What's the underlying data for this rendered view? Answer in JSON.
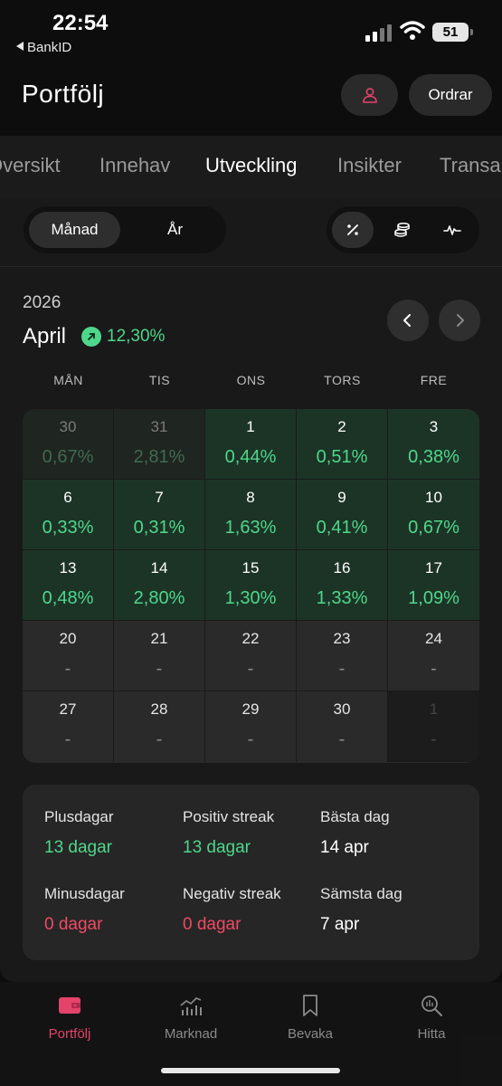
{
  "status": {
    "time": "22:54",
    "back_app": "BankID",
    "battery": "51"
  },
  "header": {
    "title": "Portfölj",
    "orders_label": "Ordrar"
  },
  "tabs": [
    "Översikt",
    "Innehav",
    "Utveckling",
    "Insikter",
    "Transaktioner"
  ],
  "period": {
    "options": [
      "Månad",
      "År"
    ],
    "selected": "Månad"
  },
  "calendar": {
    "year": "2026",
    "month": "April",
    "month_change": "12,30%",
    "weekdays": [
      "MÅN",
      "TIS",
      "ONS",
      "TORS",
      "FRE"
    ],
    "rows": [
      [
        {
          "day": "30",
          "value": "0,67%",
          "state": "muted"
        },
        {
          "day": "31",
          "value": "2,81%",
          "state": "muted"
        },
        {
          "day": "1",
          "value": "0,44%",
          "state": "pos"
        },
        {
          "day": "2",
          "value": "0,51%",
          "state": "pos"
        },
        {
          "day": "3",
          "value": "0,38%",
          "state": "pos"
        }
      ],
      [
        {
          "day": "6",
          "value": "0,33%",
          "state": "pos"
        },
        {
          "day": "7",
          "value": "0,31%",
          "state": "pos"
        },
        {
          "day": "8",
          "value": "1,63%",
          "state": "pos"
        },
        {
          "day": "9",
          "value": "0,41%",
          "state": "pos"
        },
        {
          "day": "10",
          "value": "0,67%",
          "state": "pos"
        }
      ],
      [
        {
          "day": "13",
          "value": "0,48%",
          "state": "pos"
        },
        {
          "day": "14",
          "value": "2,80%",
          "state": "pos"
        },
        {
          "day": "15",
          "value": "1,30%",
          "state": "pos"
        },
        {
          "day": "16",
          "value": "1,33%",
          "state": "pos"
        },
        {
          "day": "17",
          "value": "1,09%",
          "state": "pos"
        }
      ],
      [
        {
          "day": "20",
          "value": "-",
          "state": "empty"
        },
        {
          "day": "21",
          "value": "-",
          "state": "empty"
        },
        {
          "day": "22",
          "value": "-",
          "state": "empty"
        },
        {
          "day": "23",
          "value": "-",
          "state": "empty"
        },
        {
          "day": "24",
          "value": "-",
          "state": "empty"
        }
      ],
      [
        {
          "day": "27",
          "value": "-",
          "state": "empty"
        },
        {
          "day": "28",
          "value": "-",
          "state": "empty"
        },
        {
          "day": "29",
          "value": "-",
          "state": "empty"
        },
        {
          "day": "30",
          "value": "-",
          "state": "empty"
        },
        {
          "day": "1",
          "value": "-",
          "state": "next"
        }
      ]
    ]
  },
  "stats": {
    "plus_days_label": "Plusdagar",
    "plus_days": "13 dagar",
    "pos_streak_label": "Positiv streak",
    "pos_streak": "13 dagar",
    "best_day_label": "Bästa dag",
    "best_day": "14 apr",
    "minus_days_label": "Minusdagar",
    "minus_days": "0 dagar",
    "neg_streak_label": "Negativ streak",
    "neg_streak": "0 dagar",
    "worst_day_label": "Sämsta dag",
    "worst_day": "7 apr"
  },
  "bottom_nav": [
    "Portfölj",
    "Marknad",
    "Bevaka",
    "Hitta"
  ],
  "colors": {
    "positive": "#4ed78b",
    "negative": "#ef4a64",
    "brand": "#e4436a"
  }
}
